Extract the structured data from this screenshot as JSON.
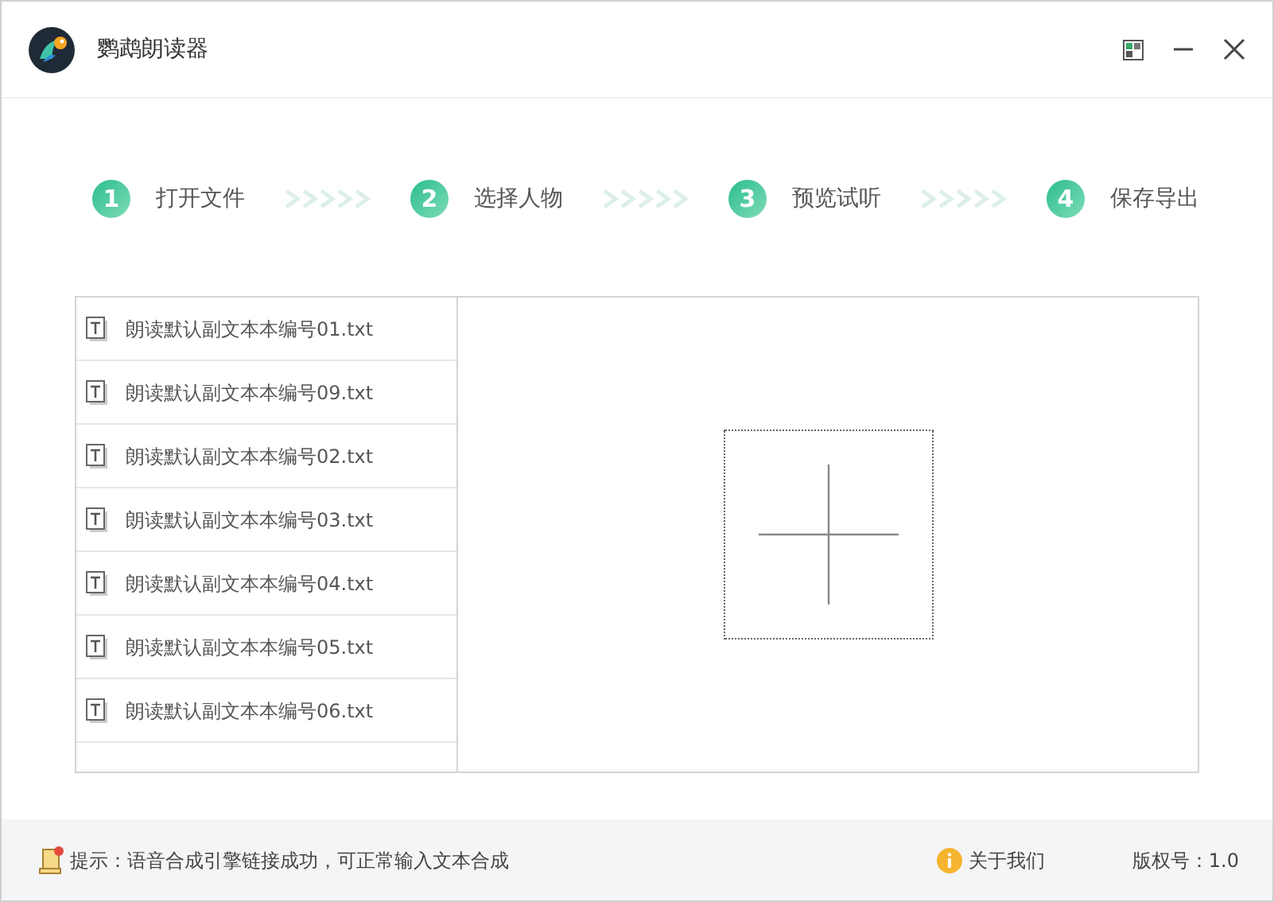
{
  "window": {
    "title": "鹦鹉朗读器"
  },
  "steps": [
    {
      "number": "1",
      "label": "打开文件"
    },
    {
      "number": "2",
      "label": "选择人物"
    },
    {
      "number": "3",
      "label": "预览试听"
    },
    {
      "number": "4",
      "label": "保存导出"
    }
  ],
  "files": [
    {
      "name": "朗读默认副文本本编号01.txt"
    },
    {
      "name": "朗读默认副文本本编号09.txt"
    },
    {
      "name": "朗读默认副文本本编号02.txt"
    },
    {
      "name": "朗读默认副文本本编号03.txt"
    },
    {
      "name": "朗读默认副文本本编号04.txt"
    },
    {
      "name": "朗读默认副文本本编号05.txt"
    },
    {
      "name": "朗读默认副文本本编号06.txt"
    }
  ],
  "status_bar": {
    "hint": "提示：语音合成引擎链接成功，可正常输入文本合成",
    "about": "关于我们",
    "version": "版权号：1.0"
  }
}
